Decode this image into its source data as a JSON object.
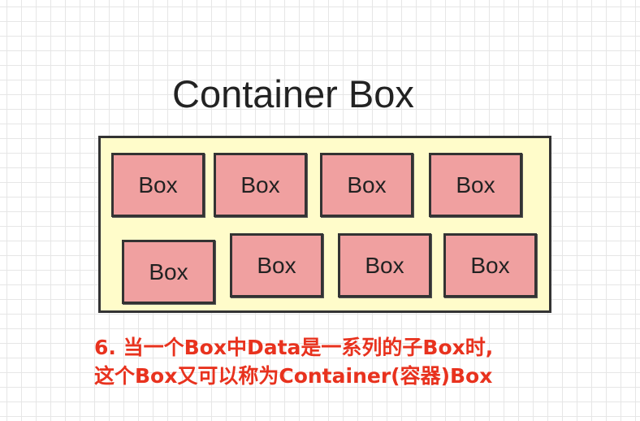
{
  "diagram": {
    "title": "Container Box",
    "boxes": [
      {
        "label": "Box"
      },
      {
        "label": "Box"
      },
      {
        "label": "Box"
      },
      {
        "label": "Box"
      },
      {
        "label": "Box"
      },
      {
        "label": "Box"
      },
      {
        "label": "Box"
      },
      {
        "label": "Box"
      }
    ],
    "caption_lines": [
      "6. 当一个Box中Data是一系列的子Box时,",
      "这个Box又可以称为Container(容器)Box"
    ]
  },
  "colors": {
    "container_fill": "#fffcca",
    "box_fill": "#f0a0a0",
    "caption_text": "#e8321e"
  }
}
